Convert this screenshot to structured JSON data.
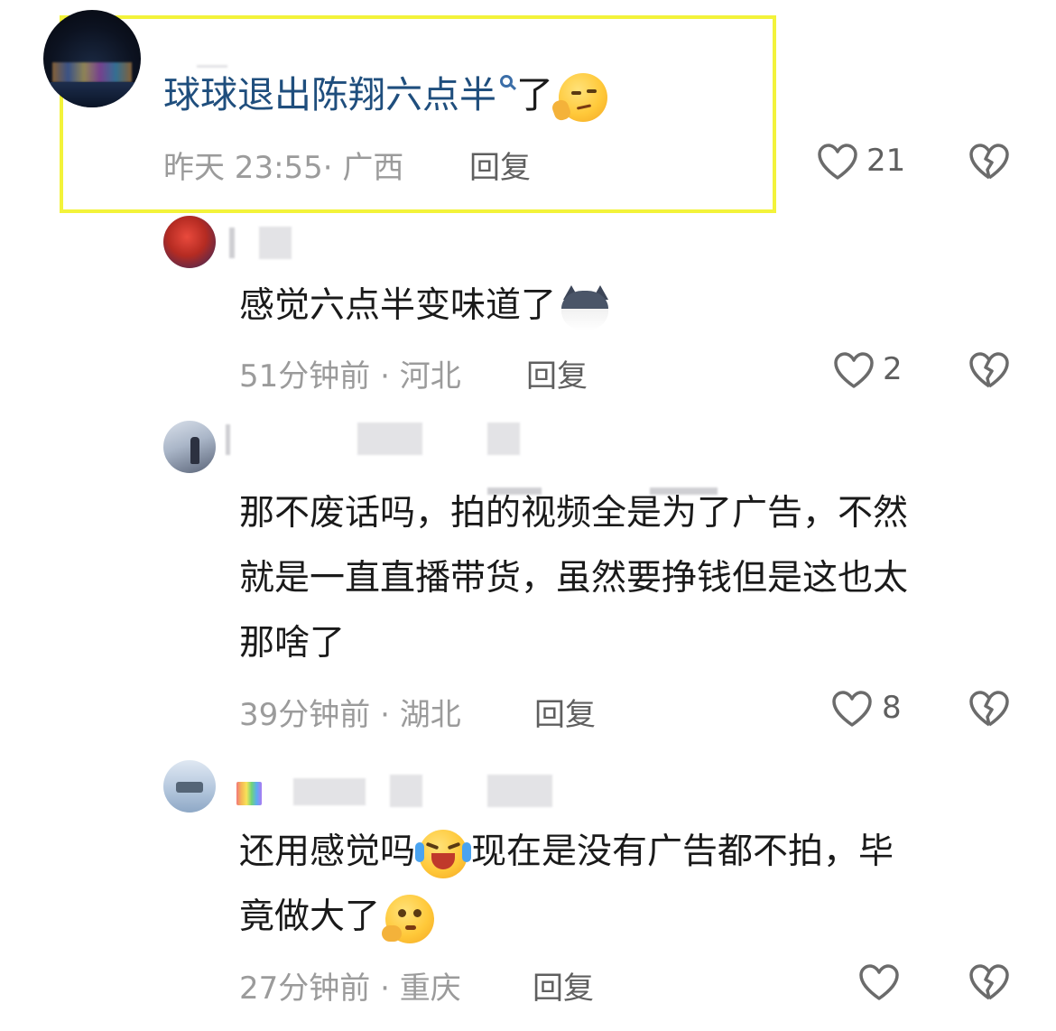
{
  "comments": [
    {
      "text_main": "球球退出陈翔六点半",
      "text_tail": "了",
      "time": "昨天 23:55",
      "region": "广西",
      "reply_label": "回复",
      "likes": "21",
      "emoji": "smirk-emoji"
    },
    {
      "text": "感觉六点半变味道了",
      "time": "51分钟前",
      "region": "河北",
      "reply_label": "回复",
      "likes": "2",
      "emoji": "wolf-emoji"
    },
    {
      "line1": "那不废话吗，拍的视频全是为了广告，不然",
      "line2": "就是一直直播带货，虽然要挣钱但是这也太",
      "line3": "那啥了",
      "time": "39分钟前",
      "region": "湖北",
      "reply_label": "回复",
      "likes": "8"
    },
    {
      "line1_a": "还用感觉吗",
      "line1_b": "现在是没有广告都不拍，毕",
      "line2": "竟做大了",
      "time": "27分钟前",
      "region": "重庆",
      "reply_label": "回复",
      "likes": "",
      "emoji1": "laughing-crying-emoji",
      "emoji2": "thinking-emoji"
    }
  ],
  "meta_separator": "·",
  "colors": {
    "highlight": "#f3f33a",
    "link_text": "#1f4e7d",
    "meta": "#9b9b9b",
    "icon": "#6b6b6b"
  }
}
